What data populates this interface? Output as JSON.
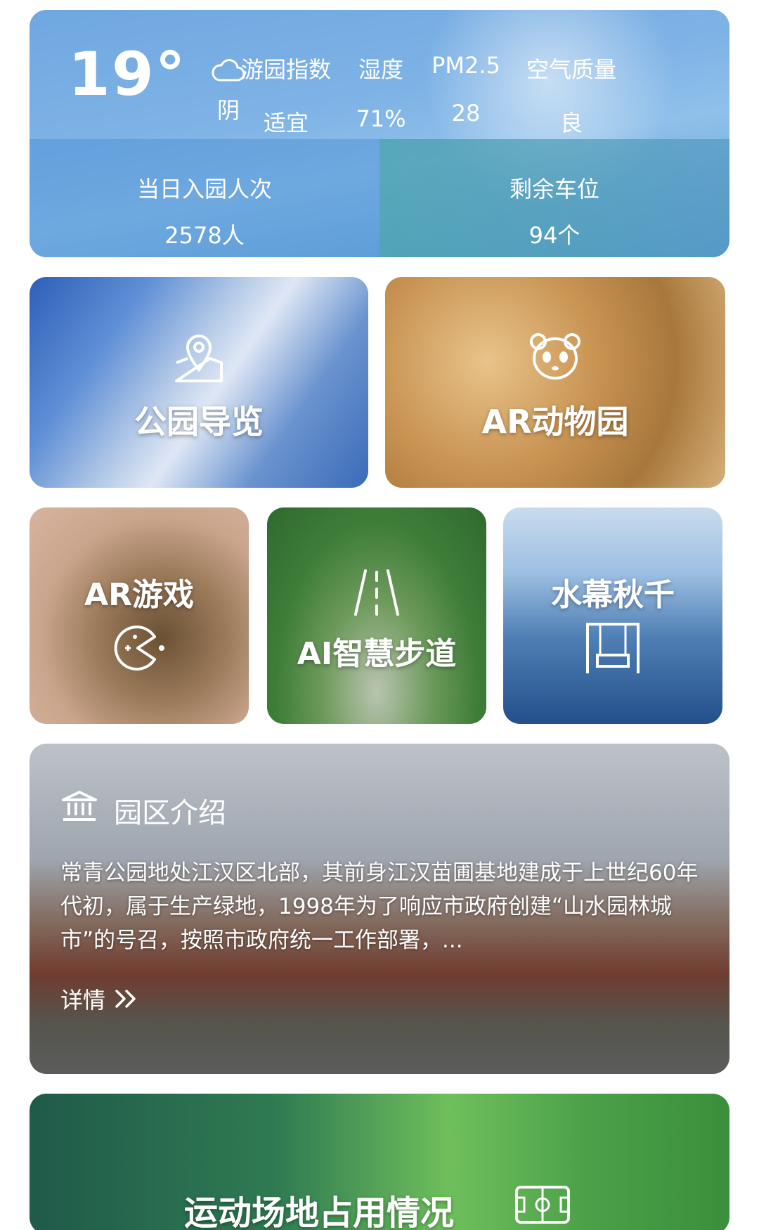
{
  "weather": {
    "temperature": "19°",
    "condition_icon": "cloud-icon",
    "condition": "阴",
    "metrics": [
      {
        "label": "游园指数",
        "value": "适宜"
      },
      {
        "label": "湿度",
        "value": "71%"
      },
      {
        "label": "PM2.5",
        "value": "28"
      },
      {
        "label": "空气质量",
        "value": "良"
      }
    ]
  },
  "stats": {
    "visitors": {
      "label": "当日入园人次",
      "value": "2578人"
    },
    "parking": {
      "label": "剩余车位",
      "value": "94个"
    }
  },
  "tiles": {
    "guide": {
      "label": "公园导览",
      "icon": "map-pin-icon"
    },
    "zoo": {
      "label": "AR动物园",
      "icon": "panda-icon"
    },
    "argame": {
      "label": "AR游戏",
      "icon": "pacman-icon"
    },
    "trail": {
      "label": "AI智慧步道",
      "icon": "road-icon"
    },
    "swing": {
      "label": "水幕秋千",
      "icon": "swing-icon"
    }
  },
  "intro": {
    "title": "园区介绍",
    "icon": "museum-icon",
    "text": "常青公园地处江汉区北部，其前身江汉苗圃基地建成于上世纪60年代初，属于生产绿地，1998年为了响应市政府创建“山水园林城市”的号召，按照市政府统一工作部署，...",
    "more_label": "详情"
  },
  "sports": {
    "label": "运动场地占用情况",
    "icon": "field-icon"
  }
}
